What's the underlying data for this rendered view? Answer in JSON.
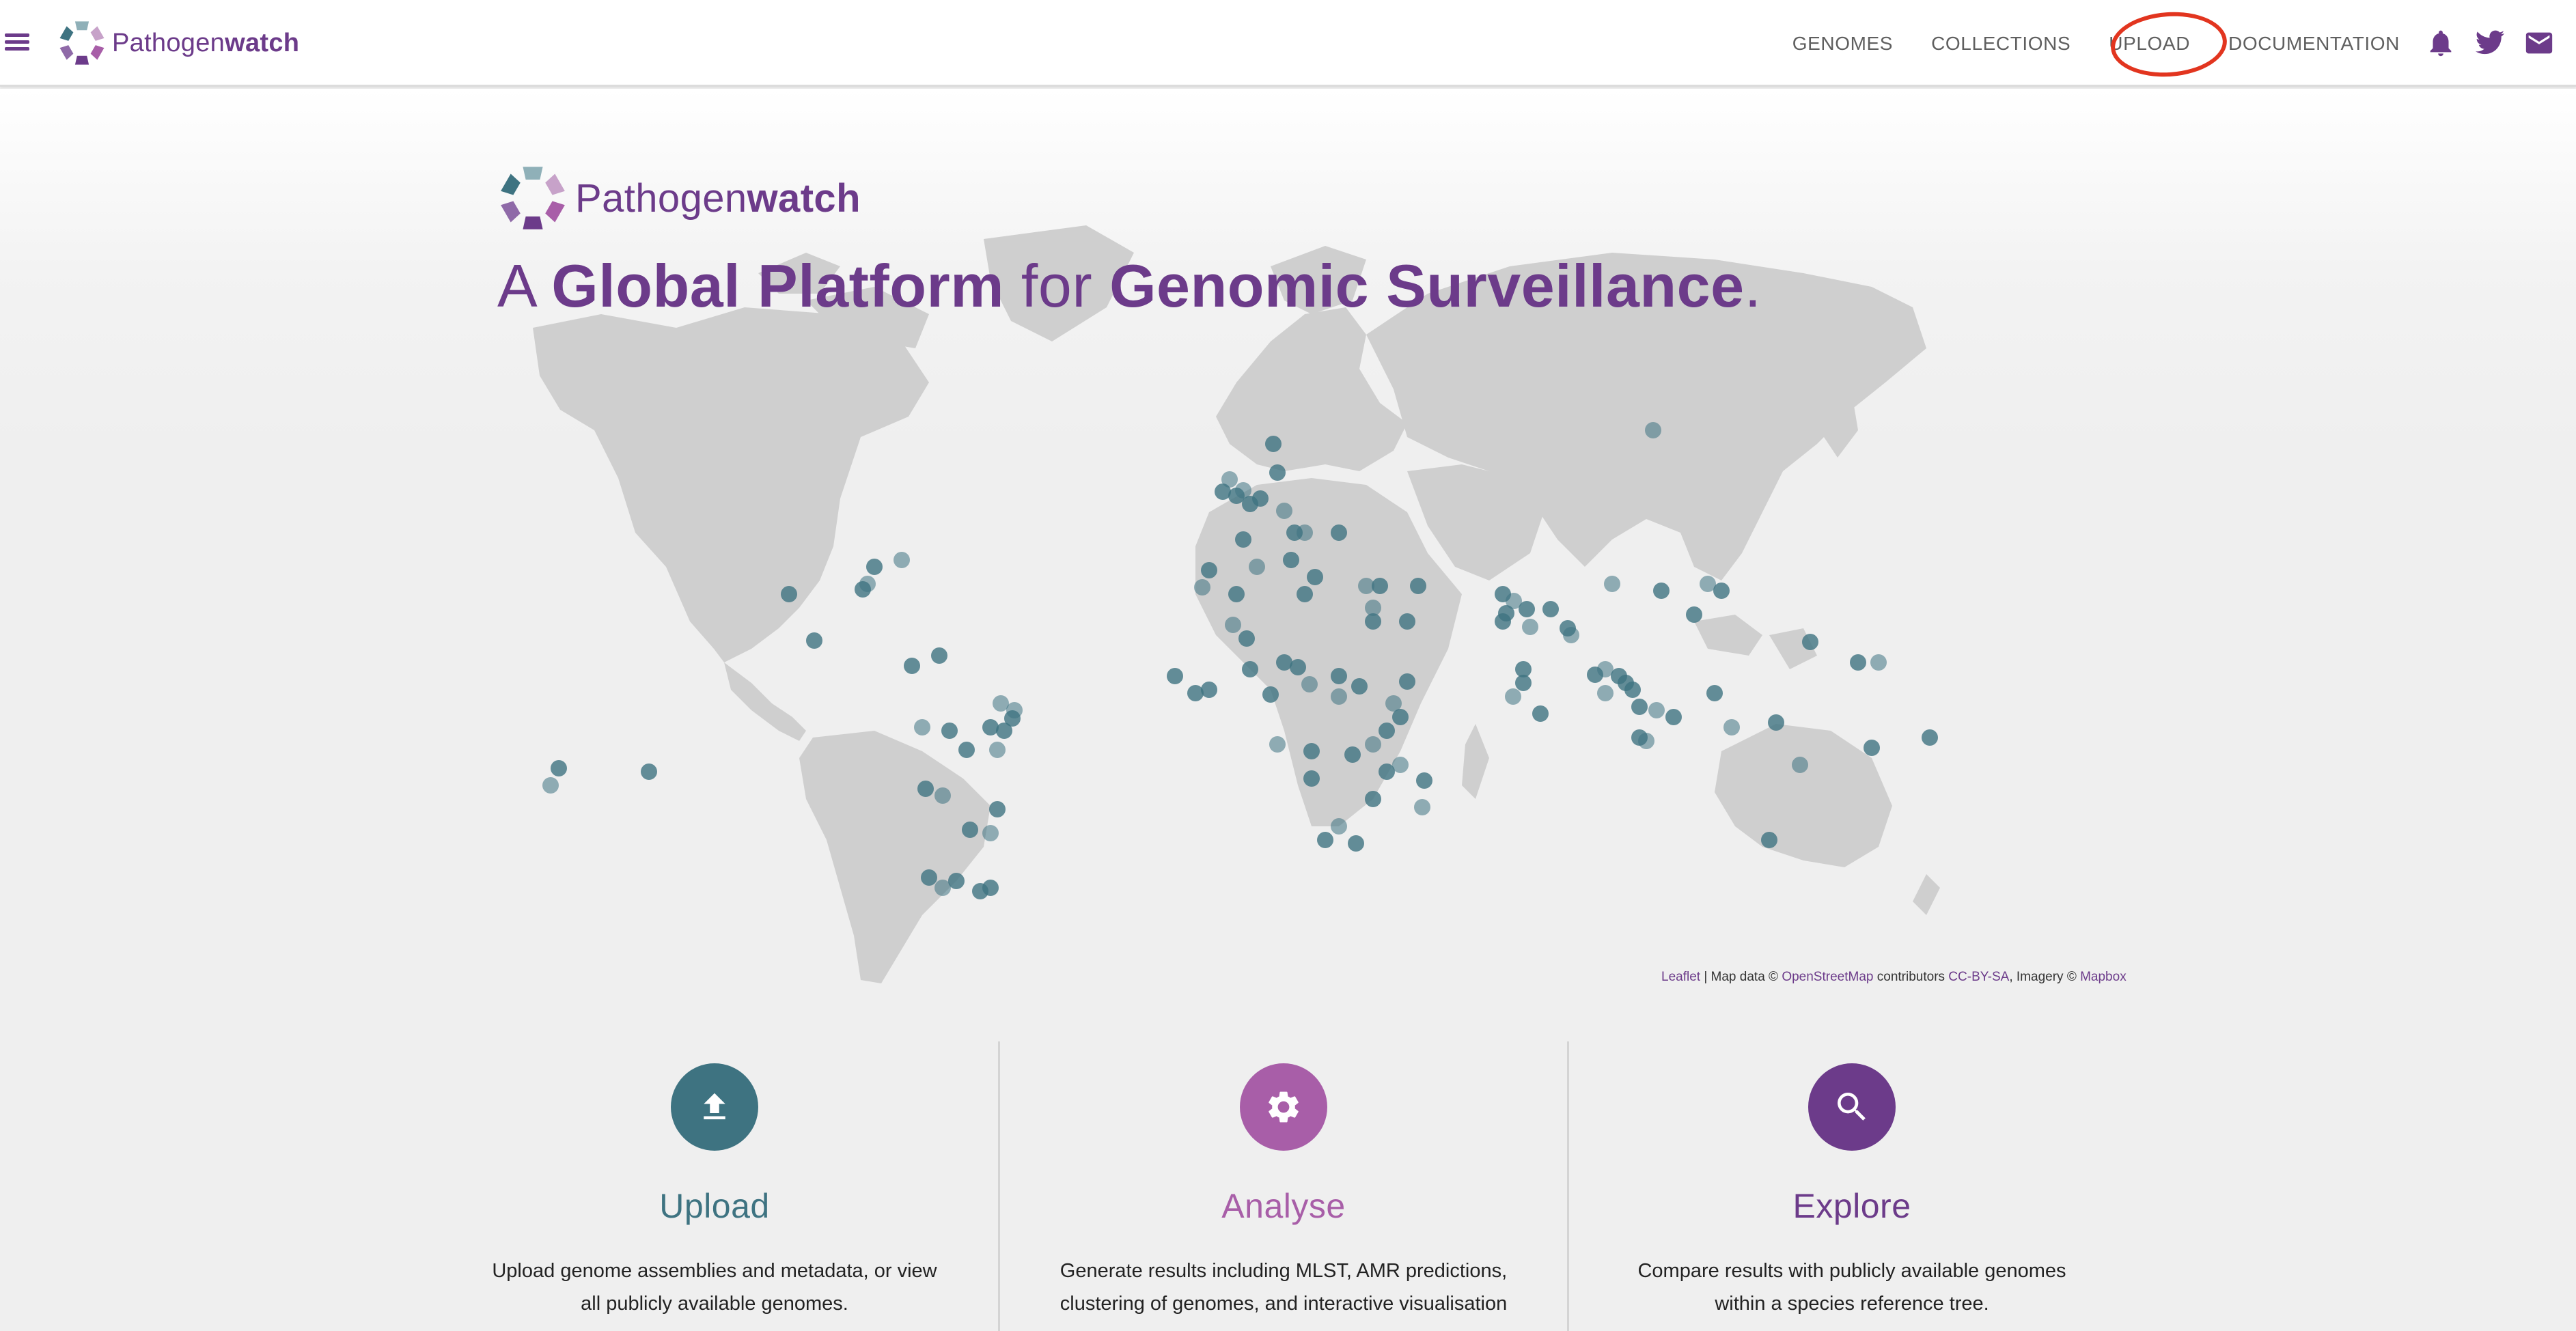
{
  "app": {
    "brand_prefix": "Pathogen",
    "brand_suffix": "watch"
  },
  "nav": {
    "items": [
      "GENOMES",
      "COLLECTIONS",
      "UPLOAD",
      "DOCUMENTATION"
    ],
    "highlighted": "UPLOAD",
    "icons": [
      "bell-icon",
      "twitter-icon",
      "mail-icon"
    ]
  },
  "hero": {
    "brand_prefix": "Pathogen",
    "brand_suffix": "watch",
    "tagline_a": "A ",
    "tagline_b": "Global Platform",
    "tagline_c": " for ",
    "tagline_d": "Genomic Surveillance",
    "tagline_e": "."
  },
  "attribution": {
    "leaflet": "Leaflet",
    "text1": " | Map data © ",
    "osm": "OpenStreetMap",
    "text2": " contributors ",
    "license": "CC-BY-SA",
    "text3": ", Imagery © ",
    "mapbox": "Mapbox"
  },
  "features": [
    {
      "title": "Upload",
      "desc_line1": "Upload genome assemblies and metadata, or view",
      "desc_line2": "all publicly available genomes.",
      "color": "#3e7381",
      "icon": "upload-icon"
    },
    {
      "title": "Analyse",
      "desc_line1": "Generate results including MLST, AMR predictions,",
      "desc_line2": "clustering of genomes, and interactive visualisation",
      "color": "#a85ea8",
      "icon": "gear-icon"
    },
    {
      "title": "Explore",
      "desc_line1": "Compare results with publicly available genomes",
      "desc_line2": "within a species reference tree.",
      "color": "#6c3b8a",
      "icon": "search-icon"
    }
  ],
  "colors": {
    "brand": "#6c3b8a",
    "marker": "#3e7381",
    "annotation": "#e2351f",
    "land": "#cfcfcf"
  }
}
